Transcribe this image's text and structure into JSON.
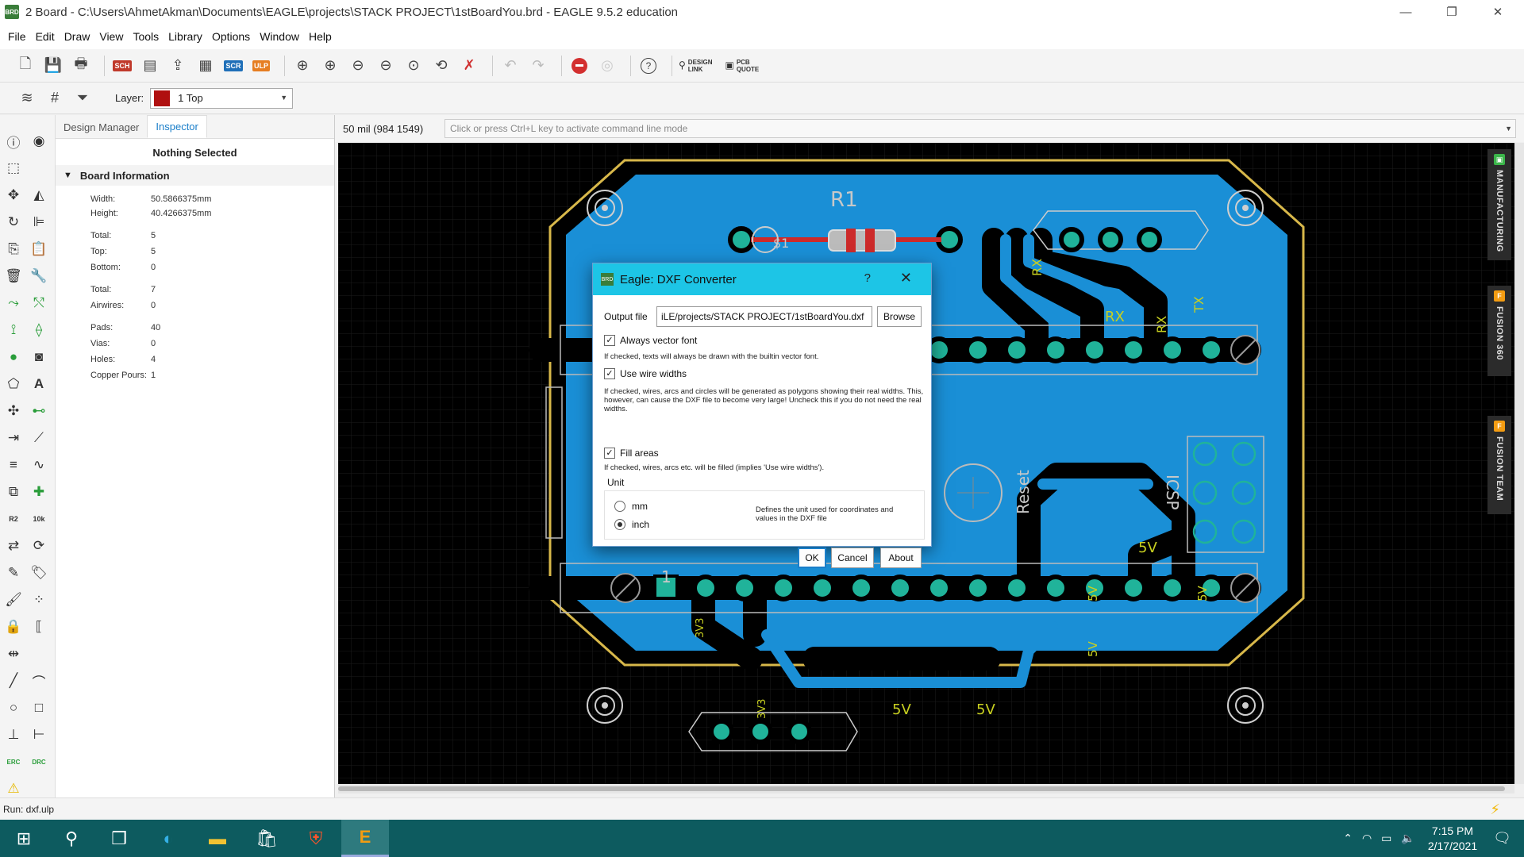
{
  "window": {
    "app_icon": "BRD",
    "title": "2 Board - C:\\Users\\AhmetAkman\\Documents\\EAGLE\\projects\\STACK PROJECT\\1stBoardYou.brd - EAGLE 9.5.2 education",
    "minimize": "—",
    "maximize": "❐",
    "close": "✕"
  },
  "menu": [
    "File",
    "Edit",
    "Draw",
    "View",
    "Tools",
    "Library",
    "Options",
    "Window",
    "Help"
  ],
  "toolbar": {
    "sch": "SCH",
    "scr": "SCR",
    "ulp": "ULP",
    "help": "?",
    "design_link": [
      "DESIGN",
      "LINK"
    ],
    "pcb_quote": [
      "PCB",
      "QUOTE"
    ]
  },
  "layer": {
    "label": "Layer:",
    "selected": "1 Top",
    "color": "#b01010"
  },
  "panel": {
    "tabs": [
      "Design Manager",
      "Inspector"
    ],
    "active_tab": "Inspector",
    "selection": "Nothing Selected",
    "section": "Board Information",
    "rows": [
      {
        "k": "Width:",
        "v": "50.5866375mm"
      },
      {
        "k": "Height:",
        "v": "40.4266375mm"
      },
      {
        "k": "Total:",
        "v": "5"
      },
      {
        "k": "Top:",
        "v": "5"
      },
      {
        "k": "Bottom:",
        "v": "0"
      },
      {
        "k": "Total:",
        "v": "7"
      },
      {
        "k": "Airwires:",
        "v": "0"
      },
      {
        "k": "Pads:",
        "v": "40"
      },
      {
        "k": "Vias:",
        "v": "0"
      },
      {
        "k": "Holes:",
        "v": "4"
      },
      {
        "k": "Copper Pours:",
        "v": "1"
      }
    ]
  },
  "command": {
    "coords": "50 mil (984 1549)",
    "placeholder": "Click or press Ctrl+L key to activate command line mode"
  },
  "board": {
    "copper_color": "#1a8fd6",
    "outline_color": "#d8b84a",
    "label_color": "#c8c8c8",
    "pad_color": "#20b39a",
    "labels": {
      "r1": "R1",
      "rx1": "RX",
      "rx2": "RX",
      "rx3": "RX",
      "tx": "TX",
      "reset": "Reset",
      "icsp": "ICSP",
      "fivev_a": "5V",
      "fivev_b": "5V",
      "fivev_c": "5V",
      "fivev_d": "5V",
      "fivev_e": "5V",
      "fivev_f": "5V",
      "one": "1",
      "v33": "3V3",
      "v33b": "3V3",
      "s1": "$1"
    }
  },
  "side_tabs": [
    {
      "label": "MANUFACTURING",
      "color": "#3bb54a"
    },
    {
      "label": "FUSION 360",
      "color": "#f39c12"
    },
    {
      "label": "FUSION TEAM",
      "color": "#f39c12"
    }
  ],
  "status": {
    "text": "Run: dxf.ulp"
  },
  "dialog": {
    "title": "Eagle: DXF Converter",
    "help": "?",
    "close": "✕",
    "output_label": "Output file",
    "output_value": "iLE/projects/STACK PROJECT/1stBoardYou.dxf",
    "browse": "Browse",
    "vector_font_label": "Always vector font",
    "vector_font_note": "If checked, texts will always be drawn with the builtin vector font.",
    "wire_widths_label": "Use wire widths",
    "wire_widths_note": "If checked, wires, arcs and circles will be generated as polygons showing their real widths. This, however, can cause the DXF file to become very large! Uncheck this if you do not need the real widths.",
    "fill_label": "Fill areas",
    "fill_note": "If checked, wires, arcs etc. will be filled (implies 'Use wire widths').",
    "unit_label": "Unit",
    "unit_mm": "mm",
    "unit_inch": "inch",
    "unit_note": "Defines the unit used for coordinates and values in the DXF file",
    "ok": "OK",
    "cancel": "Cancel",
    "about": "About",
    "check_mark": "✓"
  },
  "taskbar": {
    "time": "7:15 PM",
    "date": "2/17/2021"
  }
}
